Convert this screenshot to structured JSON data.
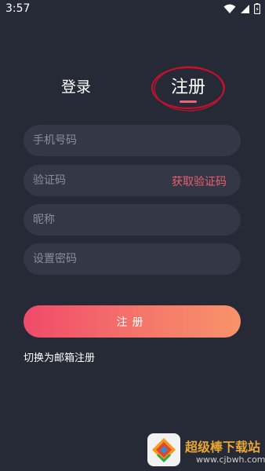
{
  "status_bar": {
    "time": "3:57",
    "icons": [
      "wifi-icon",
      "signal-icon",
      "battery-icon"
    ]
  },
  "tabs": {
    "login": "登录",
    "register": "注册",
    "active": "register"
  },
  "form": {
    "phone_placeholder": "手机号码",
    "code_placeholder": "验证码",
    "get_code_label": "获取验证码",
    "nickname_placeholder": "昵称",
    "password_placeholder": "设置密码",
    "submit_label": "注册"
  },
  "switch_link": "切换为邮箱注册",
  "watermark": {
    "title": "超级棒下载站",
    "url": "www.cjbwh.com"
  },
  "colors": {
    "background": "#262a36",
    "field": "#343846",
    "accent": "#f0617a",
    "gradient_start": "#f04a6a",
    "gradient_end": "#f8936a",
    "annotation": "#c8102e"
  }
}
